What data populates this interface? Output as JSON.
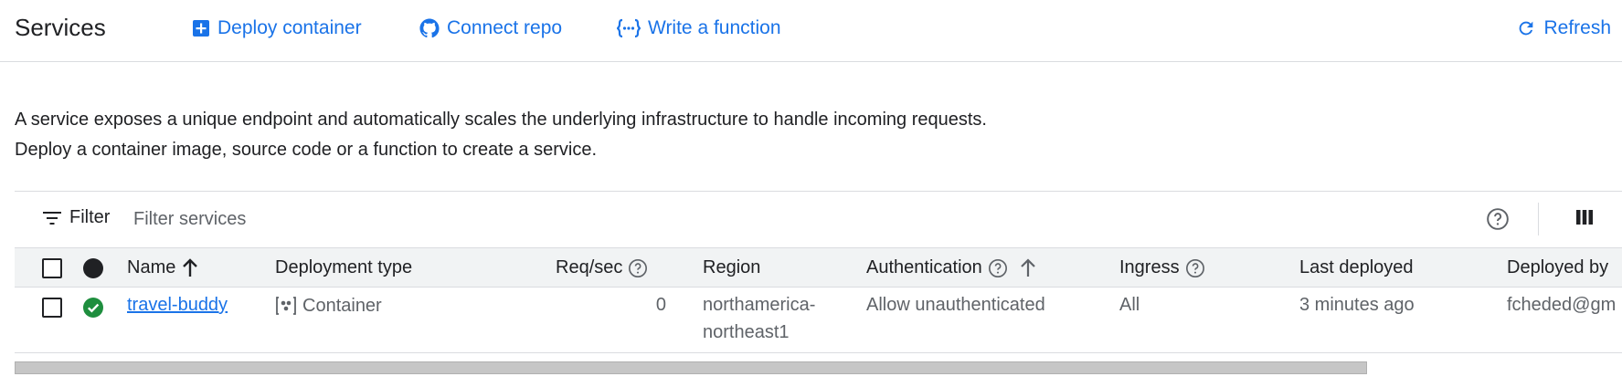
{
  "header": {
    "title": "Services",
    "deploy_container": "Deploy container",
    "connect_repo": "Connect repo",
    "write_function": "Write a function",
    "refresh": "Refresh"
  },
  "description": {
    "line1": "A service exposes a unique endpoint and automatically scales the underlying infrastructure to handle incoming requests.",
    "line2": "Deploy a container image, source code or a function to create a service."
  },
  "toolbar": {
    "filter_label": "Filter",
    "filter_placeholder": "Filter services"
  },
  "table": {
    "columns": {
      "name": "Name",
      "deployment_type": "Deployment type",
      "req_sec": "Req/sec",
      "region": "Region",
      "authentication": "Authentication",
      "ingress": "Ingress",
      "last_deployed": "Last deployed",
      "deployed_by": "Deployed by"
    },
    "rows": [
      {
        "status": "ok",
        "name": "travel-buddy",
        "deployment_type": "Container",
        "req_sec": "0",
        "region": "northamerica-northeast1",
        "authentication": "Allow unauthenticated",
        "ingress": "All",
        "last_deployed": "3 minutes ago",
        "deployed_by": "fcheded@gm"
      }
    ]
  },
  "colors": {
    "accent": "#1a73e8",
    "success": "#1e8e3e",
    "text": "#202124",
    "muted": "#5f6368",
    "border": "#dadce0",
    "header_bg": "#f1f3f4"
  }
}
